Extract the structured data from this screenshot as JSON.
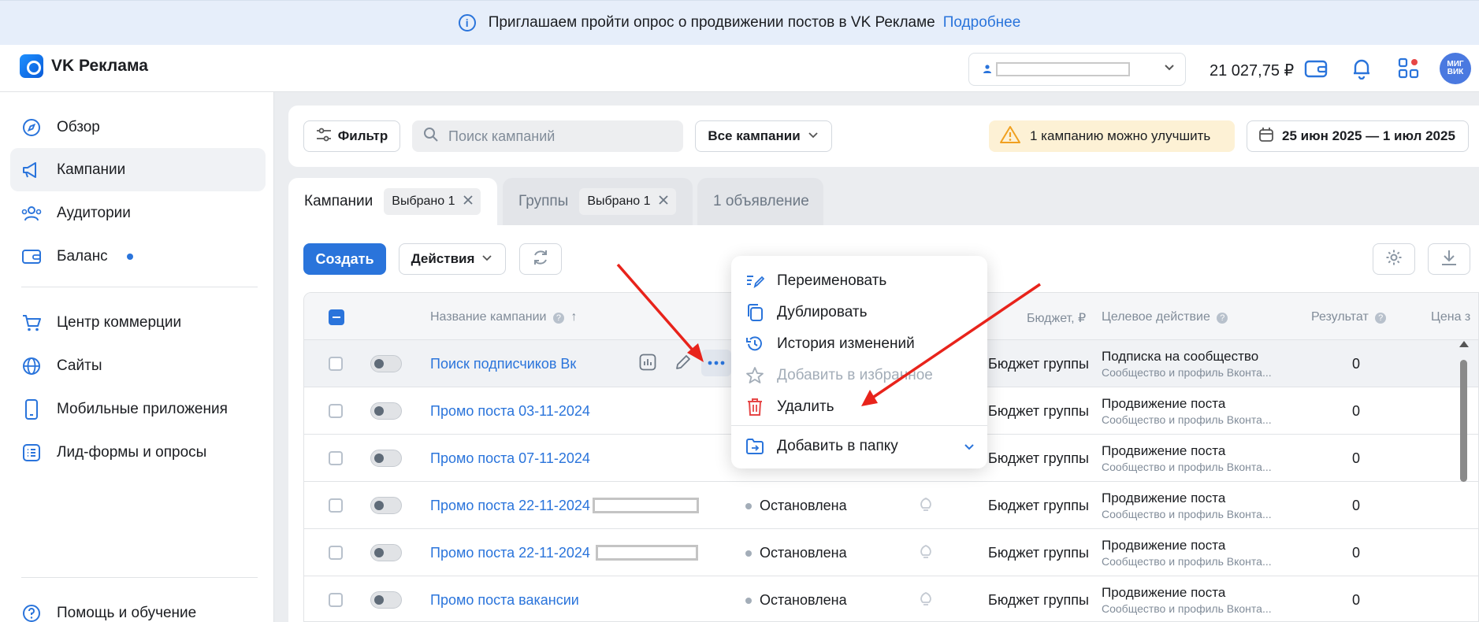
{
  "banner": {
    "text": "Приглашаем пройти опрос о продвижении постов в VK Рекламе",
    "link": "Подробнее"
  },
  "topbar": {
    "logo": "VK Реклама",
    "balance": "21 027,75 ₽",
    "avatar_text": "МИГ ВИК"
  },
  "sidebar": {
    "items": [
      {
        "label": "Обзор",
        "icon": "compass-icon"
      },
      {
        "label": "Кампании",
        "icon": "megaphone-icon"
      },
      {
        "label": "Аудитории",
        "icon": "users-icon"
      },
      {
        "label": "Баланс",
        "icon": "wallet-icon"
      },
      {
        "label": "Центр коммерции",
        "icon": "cart-icon"
      },
      {
        "label": "Сайты",
        "icon": "globe-icon"
      },
      {
        "label": "Мобильные приложения",
        "icon": "phone-icon"
      },
      {
        "label": "Лид-формы и опросы",
        "icon": "list-icon"
      },
      {
        "label": "Помощь и обучение",
        "icon": "help-icon"
      }
    ]
  },
  "filter": {
    "filter_label": "Фильтр",
    "search_placeholder": "Поиск кампаний",
    "all_campaigns": "Все кампании",
    "warning": "1 кампанию можно улучшить",
    "date_range": "25 июн 2025 — 1 июл 2025"
  },
  "tabs": [
    {
      "label": "Кампании",
      "chip": "Выбрано 1"
    },
    {
      "label": "Группы",
      "chip": "Выбрано 1"
    },
    {
      "label": "1 объявление"
    }
  ],
  "toolbar": {
    "create": "Создать",
    "actions": "Действия"
  },
  "table": {
    "headers": {
      "name": "Название кампании",
      "budget": "Бюджет, ₽",
      "target": "Целевое действие",
      "result": "Результат",
      "price": "Цена з"
    },
    "rows": [
      {
        "name": "Поиск подписчиков Вк",
        "status": "",
        "budget": "Бюджет группы",
        "target": "Подписка на сообщество",
        "target_sub": "Сообщество и профиль Вконта...",
        "result": "0"
      },
      {
        "name": "Промо поста 03-11-2024",
        "status": "",
        "budget": "Бюджет группы",
        "target": "Продвижение поста",
        "target_sub": "Сообщество и профиль Вконта...",
        "result": "0"
      },
      {
        "name": "Промо поста 07-11-2024",
        "status": "",
        "budget": "Бюджет группы",
        "target": "Продвижение поста",
        "target_sub": "Сообщество и профиль Вконта...",
        "result": "0"
      },
      {
        "name": "Промо поста 22-11-2024",
        "status": "Остановлена",
        "budget": "Бюджет группы",
        "target": "Продвижение поста",
        "target_sub": "Сообщество и профиль Вконта...",
        "result": "0"
      },
      {
        "name": "Промо поста 22-11-2024",
        "status": "Остановлена",
        "budget": "Бюджет группы",
        "target": "Продвижение поста",
        "target_sub": "Сообщество и профиль Вконта...",
        "result": "0"
      },
      {
        "name": "Промо поста вакансии",
        "status": "Остановлена",
        "budget": "Бюджет группы",
        "target": "Продвижение поста",
        "target_sub": "Сообщество и профиль Вконта...",
        "result": "0"
      }
    ]
  },
  "menu": {
    "items": [
      {
        "label": "Переименовать",
        "icon": "rename-icon"
      },
      {
        "label": "Дублировать",
        "icon": "duplicate-icon"
      },
      {
        "label": "История изменений",
        "icon": "history-icon"
      },
      {
        "label": "Добавить в избранное",
        "icon": "star-icon",
        "disabled": true
      },
      {
        "label": "Удалить",
        "icon": "trash-icon"
      },
      {
        "label": "Добавить в папку",
        "icon": "folder-icon"
      }
    ]
  },
  "colors": {
    "accent": "#2a74db",
    "danger": "#e64646",
    "annotation_arrow": "#e8231b",
    "warning_bg": "#fdf1d5"
  }
}
